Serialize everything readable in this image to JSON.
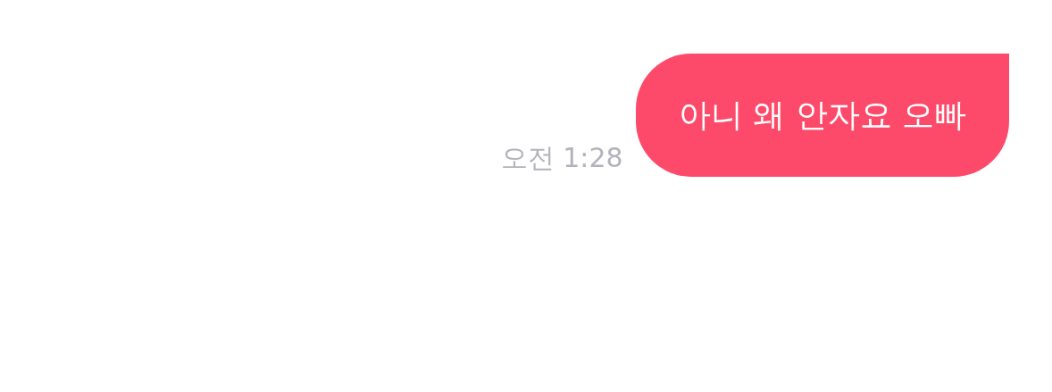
{
  "messages": [
    {
      "kind": "outgoing",
      "time": "오전 1:28",
      "text": "아니 왜 안자요 오빠"
    }
  ]
}
